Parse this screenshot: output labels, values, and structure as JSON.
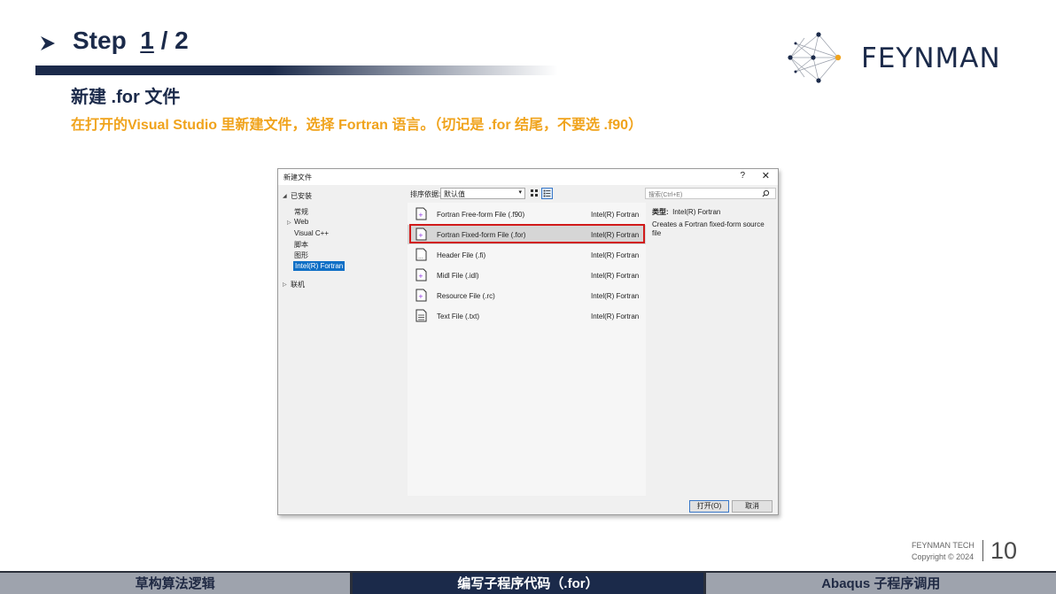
{
  "header": {
    "step_word": "Step",
    "step_current": "1",
    "step_rest": " / 2",
    "logo_text": "FEYNMAN"
  },
  "section": {
    "title": "新建 .for 文件",
    "instruction": "在打开的Visual  Studio 里新建文件，选择 Fortran 语言。（切记是 .for 结尾，不要选 .f90）"
  },
  "dialog": {
    "title": "新建文件",
    "help": "?",
    "close": "✕",
    "tree": {
      "installed": "已安装",
      "items": [
        "常规",
        "Web",
        "Visual C++",
        "脚本",
        "图形",
        "Intel(R) Fortran"
      ],
      "online": "联机"
    },
    "sort_label": "排序依据:",
    "sort_value": "默认值",
    "search_placeholder": "搜索(Ctrl+E)",
    "files": [
      {
        "name": "Fortran Free-form File (.f90)",
        "lang": "Intel(R) Fortran"
      },
      {
        "name": "Fortran Fixed-form File (.for)",
        "lang": "Intel(R) Fortran"
      },
      {
        "name": "Header File (.fi)",
        "lang": "Intel(R) Fortran"
      },
      {
        "name": "Midl File (.idl)",
        "lang": "Intel(R) Fortran"
      },
      {
        "name": "Resource File (.rc)",
        "lang": "Intel(R) Fortran"
      },
      {
        "name": "Text File (.txt)",
        "lang": "Intel(R) Fortran"
      }
    ],
    "info": {
      "type_label": "类型:",
      "type_value": "Intel(R) Fortran",
      "description": "Creates a Fortran fixed-form source file"
    },
    "open_button": "打开(O)",
    "cancel_button": "取消"
  },
  "footer": {
    "company": "FEYNMAN TECH",
    "copyright": "Copyright © 2024",
    "page_number": "10"
  },
  "bottom_nav": [
    "草构算法逻辑",
    "编写子程序代码（.for）",
    "Abaqus 子程序调用"
  ],
  "colors": {
    "navy": "#1b2a4a",
    "accent_orange": "#f0a31c",
    "highlight_red": "#d11a1a",
    "selection_blue": "#0f6fc6"
  }
}
